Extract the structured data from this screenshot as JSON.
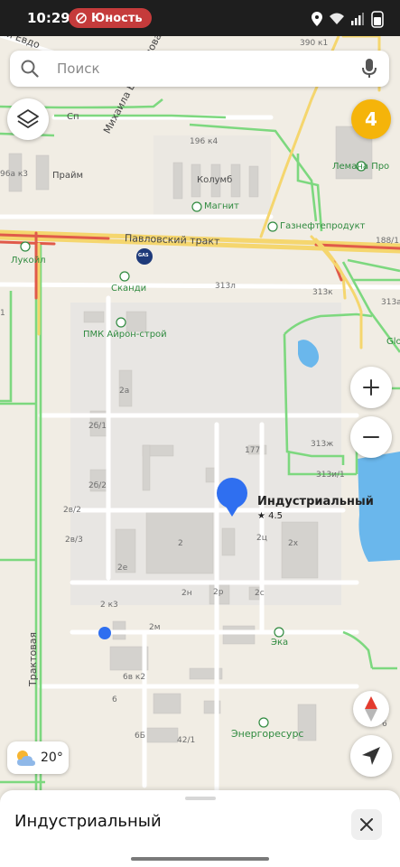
{
  "status_bar": {
    "time": "10:29",
    "app_pill": "Юность"
  },
  "search": {
    "placeholder": "Поиск"
  },
  "map": {
    "streets": {
      "pavlovsky": "Павловский тракт",
      "evdokimova": "Михаила Евдокимова",
      "traktovaya": "Трактовая",
      "partial_top_left": "ия Евдо"
    },
    "house_numbers": {
      "n390k1": "390 к1",
      "n196k4": "196 к4",
      "n96ak3": "96а к3",
      "n188": "188/1",
      "n313l": "313л",
      "n313k": "313к",
      "n313a": "313а",
      "n1": "1",
      "n2a": "2а",
      "n2b1": "2б/1",
      "n2b2": "2б/2",
      "n2v2": "2в/2",
      "n2v3": "2в/3",
      "n2e": "2е",
      "n2": "2",
      "n177": "177",
      "n313zh": "313ж",
      "n313i1": "313и/1",
      "n2ts": "2ц",
      "n2kh": "2х",
      "n2n": "2н",
      "n2r": "2р",
      "n2s": "2с",
      "n2k3": "2 к3",
      "n2m": "2м",
      "n6vk2": "6в к2",
      "n6": "6",
      "n6b": "6Б",
      "n42_1": "42/1",
      "n6_right": "6"
    },
    "pois": {
      "magnit": "Магнит",
      "kolumb": "Колумб",
      "gazneft": "Газнефтепродукт",
      "lemana": "Лемана Про",
      "lukoil": "Лукойл",
      "skandi": "Сканди",
      "pmk": "ПМК Айрон-строй",
      "prime": "Прайм",
      "sport": "Сп",
      "eka": "Эка",
      "energoresurs": "Энергоресурс",
      "glo": "Glo"
    },
    "selected_place": {
      "name": "Индустриальный",
      "rating": "★ 4.5"
    },
    "cluster_count": "4",
    "gas_logo": "GAS"
  },
  "weather": {
    "temp": "20°"
  },
  "bottom_sheet": {
    "title": "Индустриальный"
  },
  "icons": {
    "search": "search-icon",
    "mic": "microphone-icon",
    "layers": "layers-icon",
    "zoom_in": "plus-icon",
    "zoom_out": "minus-icon",
    "compass": "compass-icon",
    "location": "location-arrow-icon",
    "weather": "partly-cloudy-icon",
    "close": "close-icon"
  },
  "colors": {
    "map_bg": "#f1ede4",
    "road_main": "#f5d66e",
    "road_congested": "#e05a4a",
    "road_free": "#7dd87f",
    "water": "#6ab7ec",
    "accent_blue": "#2f6ff0",
    "cluster": "#f5b40a"
  }
}
